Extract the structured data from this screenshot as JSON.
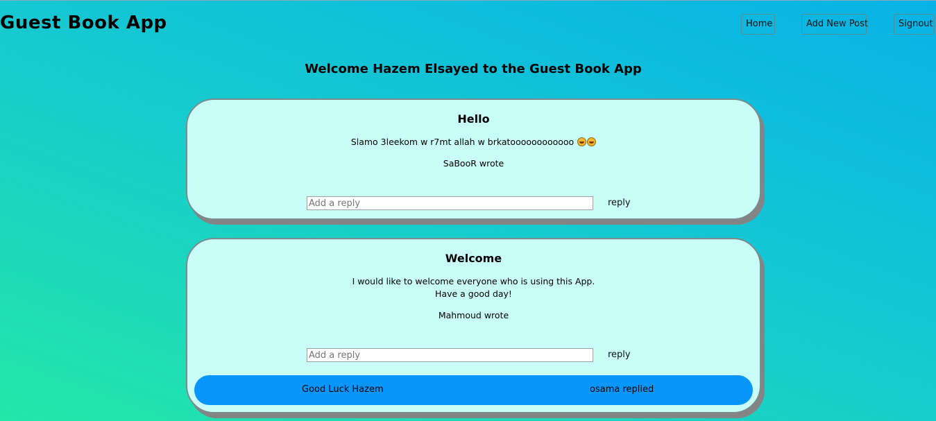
{
  "header": {
    "app_title": "Guest Book App",
    "nav": {
      "home": "Home",
      "add_new_post": "Add New Post",
      "signout": "Signout"
    }
  },
  "welcome_message": "Welcome Hazem Elsayed to the Guest Book App",
  "posts": [
    {
      "title": "Hello",
      "body": "Slamo 3leekom w r7mt allah w brkatoooooooooooo",
      "emojis": [
        "grinning-face-icon",
        "grinning-face-icon"
      ],
      "author_line": "SaBooR wrote",
      "reply_placeholder": "Add a reply",
      "reply_button": "reply",
      "replies": []
    },
    {
      "title": "Welcome",
      "body_lines": [
        "I would like to welcome everyone who is using this App.",
        "Have a good day!"
      ],
      "author_line": "Mahmoud wrote",
      "reply_placeholder": "Add a reply",
      "reply_button": "reply",
      "replies": [
        {
          "text": "Good Luck Hazem",
          "author_line": "osama replied"
        }
      ]
    }
  ],
  "colors": {
    "card_background": "#c8fdf8",
    "reply_background": "#0896fa",
    "gradient_top_right": "#09b2e6",
    "gradient_bottom_left": "#24e6a8"
  }
}
